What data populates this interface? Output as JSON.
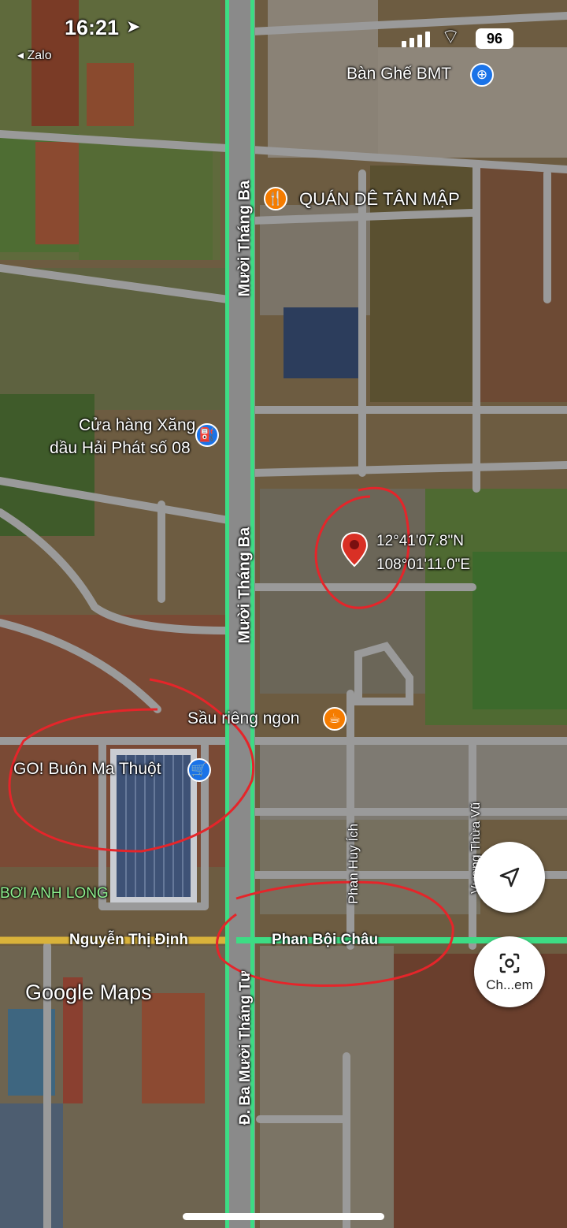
{
  "status_bar": {
    "time": "16:21",
    "back_app": "Zalo",
    "battery": "96"
  },
  "colors": {
    "main_road_green": "#3ddc84",
    "road_gray": "#9a9a9a",
    "pin_blue": "#1a73e8",
    "pin_orange": "#f57c00",
    "pin_red": "#d93025",
    "annotation_red": "#e5252a"
  },
  "places": {
    "ban_ghe": "Bàn Ghế BMT",
    "quan_de": "QUÁN DÊ TÂN MẬP",
    "xang_line1": "Cửa hàng Xăng",
    "xang_line2": "dầu Hải Phát số 08",
    "sau_rieng": "Sầu riêng ngon",
    "go": "GO! Buôn Ma Thuột",
    "boi": "BƠI ANH LONG"
  },
  "roads": {
    "muoi_thang_ba_1": "Mười Tháng Ba",
    "muoi_thang_ba_2": "Mười Tháng Ba",
    "nguyen_thi_dinh": "Nguyễn Thị Định",
    "phan_boi_chau": "Phan Bội Châu",
    "phan_huy_ich": "Phan Huy Ích",
    "vuong_thua_vu": "Vương Thừa Vũ",
    "duong_ba_muoi": "Đ. Ba Mười Tháng Tư"
  },
  "coordinates": {
    "lat": "12°41'07.8\"N",
    "lng": "108°01'11.0\"E"
  },
  "watermark": "Google Maps",
  "buttons": {
    "locate_icon": "navigation-arrow-icon",
    "lens_label": "Ch...em",
    "lens_icon": "lens-icon"
  }
}
